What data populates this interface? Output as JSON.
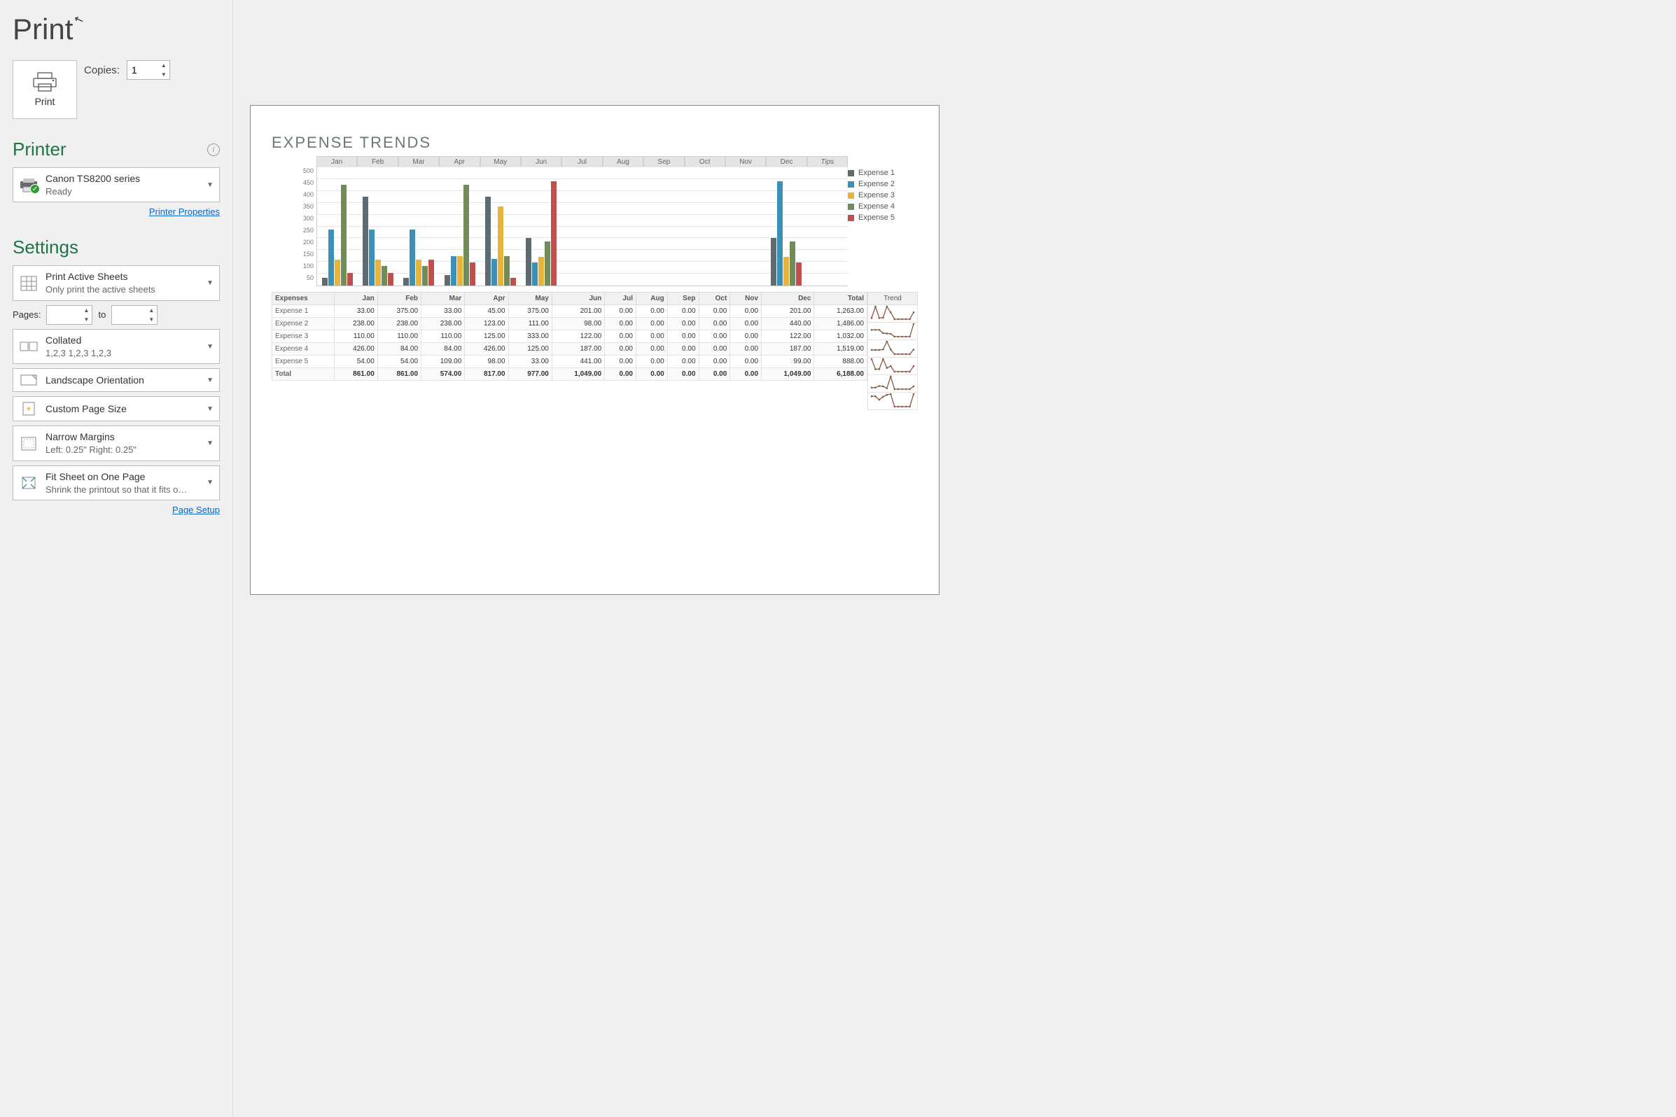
{
  "view_title": "Print",
  "print_button": {
    "label": "Print"
  },
  "copies": {
    "label": "Copies:",
    "value": "1"
  },
  "printer_section": {
    "header": "Printer",
    "name": "Canon TS8200 series",
    "status": "Ready",
    "properties_link": "Printer Properties"
  },
  "settings_section": {
    "header": "Settings",
    "active_sheets": {
      "title": "Print Active Sheets",
      "sub": "Only print the active sheets"
    },
    "pages_label": "Pages:",
    "pages_to": "to",
    "collated": {
      "title": "Collated",
      "sub": "1,2,3    1,2,3    1,2,3"
    },
    "orientation": {
      "title": "Landscape Orientation"
    },
    "page_size": {
      "title": "Custom Page Size"
    },
    "margins": {
      "title": "Narrow Margins",
      "sub": "Left:  0.25\"     Right:  0.25\""
    },
    "scaling": {
      "title": "Fit Sheet on One Page",
      "sub": "Shrink the printout so that it fits o…"
    },
    "page_setup_link": "Page Setup"
  },
  "preview": {
    "title": "EXPENSE TRENDS",
    "months_header_extra": "Tips",
    "table_headers": [
      "Expenses",
      "Jan",
      "Feb",
      "Mar",
      "Apr",
      "May",
      "Jun",
      "Jul",
      "Aug",
      "Sep",
      "Oct",
      "Nov",
      "Dec",
      "Total"
    ],
    "trend_header": "Trend",
    "legend_prefix": "Expense"
  },
  "chart_data": {
    "type": "bar",
    "title": "EXPENSE TRENDS",
    "xlabel": "",
    "ylabel": "",
    "ylim": [
      0,
      500
    ],
    "yticks": [
      50,
      100,
      150,
      200,
      250,
      300,
      350,
      400,
      450,
      500
    ],
    "categories": [
      "Jan",
      "Feb",
      "Mar",
      "Apr",
      "May",
      "Jun",
      "Jul",
      "Aug",
      "Sep",
      "Oct",
      "Nov",
      "Dec"
    ],
    "series": [
      {
        "name": "Expense 1",
        "color": "#5e6b72",
        "values": [
          33,
          375,
          33,
          45,
          375,
          201,
          0,
          0,
          0,
          0,
          0,
          201
        ]
      },
      {
        "name": "Expense 2",
        "color": "#3c8fb5",
        "values": [
          238,
          238,
          238,
          123,
          111,
          98,
          0,
          0,
          0,
          0,
          0,
          440
        ]
      },
      {
        "name": "Expense 3",
        "color": "#e8b33b",
        "values": [
          110,
          110,
          110,
          125,
          333,
          122,
          0,
          0,
          0,
          0,
          0,
          122
        ]
      },
      {
        "name": "Expense 4",
        "color": "#6f8c5a",
        "values": [
          426,
          84,
          84,
          426,
          125,
          187,
          0,
          0,
          0,
          0,
          0,
          187
        ]
      },
      {
        "name": "Expense 5",
        "color": "#c0504d",
        "values": [
          54,
          54,
          109,
          98,
          33,
          441,
          0,
          0,
          0,
          0,
          0,
          99
        ]
      }
    ],
    "table_rows": [
      {
        "label": "Expense 1",
        "cells": [
          "33.00",
          "375.00",
          "33.00",
          "45.00",
          "375.00",
          "201.00",
          "0.00",
          "0.00",
          "0.00",
          "0.00",
          "0.00",
          "201.00",
          "1,263.00"
        ]
      },
      {
        "label": "Expense 2",
        "cells": [
          "238.00",
          "238.00",
          "238.00",
          "123.00",
          "111.00",
          "98.00",
          "0.00",
          "0.00",
          "0.00",
          "0.00",
          "0.00",
          "440.00",
          "1,486.00"
        ]
      },
      {
        "label": "Expense 3",
        "cells": [
          "110.00",
          "110.00",
          "110.00",
          "125.00",
          "333.00",
          "122.00",
          "0.00",
          "0.00",
          "0.00",
          "0.00",
          "0.00",
          "122.00",
          "1,032.00"
        ]
      },
      {
        "label": "Expense 4",
        "cells": [
          "426.00",
          "84.00",
          "84.00",
          "426.00",
          "125.00",
          "187.00",
          "0.00",
          "0.00",
          "0.00",
          "0.00",
          "0.00",
          "187.00",
          "1,519.00"
        ]
      },
      {
        "label": "Expense 5",
        "cells": [
          "54.00",
          "54.00",
          "109.00",
          "98.00",
          "33.00",
          "441.00",
          "0.00",
          "0.00",
          "0.00",
          "0.00",
          "0.00",
          "99.00",
          "888.00"
        ]
      }
    ],
    "totals_row": {
      "label": "Total",
      "cells": [
        "861.00",
        "861.00",
        "574.00",
        "817.00",
        "977.00",
        "1,049.00",
        "0.00",
        "0.00",
        "0.00",
        "0.00",
        "0.00",
        "1,049.00",
        "6,188.00"
      ]
    }
  }
}
